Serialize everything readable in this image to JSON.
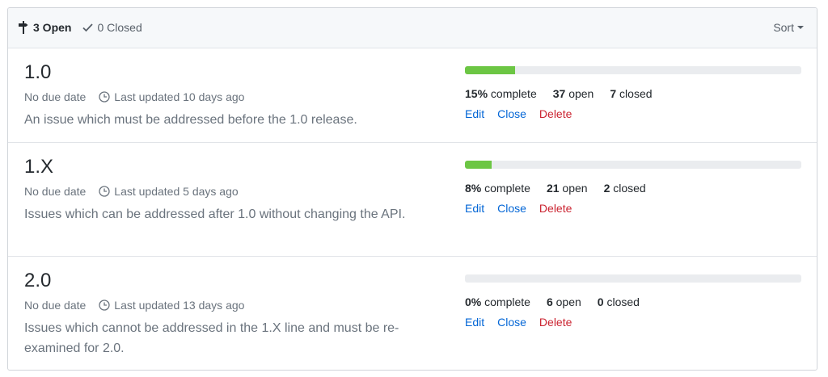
{
  "header": {
    "open_label": "3 Open",
    "closed_label": "0 Closed",
    "sort_label": "Sort"
  },
  "milestones": [
    {
      "title": "1.0",
      "due": "No due date",
      "updated": "Last updated 10 days ago",
      "description": "An issue which must be addressed before the 1.0 release.",
      "percent": 15,
      "percent_label": "15%",
      "complete_label": "complete",
      "open_count": "37",
      "open_label": "open",
      "closed_count": "7",
      "closed_label": "closed",
      "actions": {
        "edit": "Edit",
        "close": "Close",
        "delete": "Delete"
      }
    },
    {
      "title": "1.X",
      "due": "No due date",
      "updated": "Last updated 5 days ago",
      "description": "Issues which can be addressed after 1.0 without changing the API.",
      "percent": 8,
      "percent_label": "8%",
      "complete_label": "complete",
      "open_count": "21",
      "open_label": "open",
      "closed_count": "2",
      "closed_label": "closed",
      "actions": {
        "edit": "Edit",
        "close": "Close",
        "delete": "Delete"
      }
    },
    {
      "title": "2.0",
      "due": "No due date",
      "updated": "Last updated 13 days ago",
      "description": "Issues which cannot be addressed in the 1.X line and must be re-examined for 2.0.",
      "percent": 0,
      "percent_label": "0%",
      "complete_label": "complete",
      "open_count": "6",
      "open_label": "open",
      "closed_count": "0",
      "closed_label": "closed",
      "actions": {
        "edit": "Edit",
        "close": "Close",
        "delete": "Delete"
      }
    }
  ],
  "icons": {
    "open": "milestone-icon",
    "closed": "check-icon",
    "updated": "clock-icon"
  },
  "colors": {
    "progress_fill": "#6cc644",
    "progress_track": "#eaecef",
    "link": "#0366d6",
    "delete": "#cb2431"
  }
}
